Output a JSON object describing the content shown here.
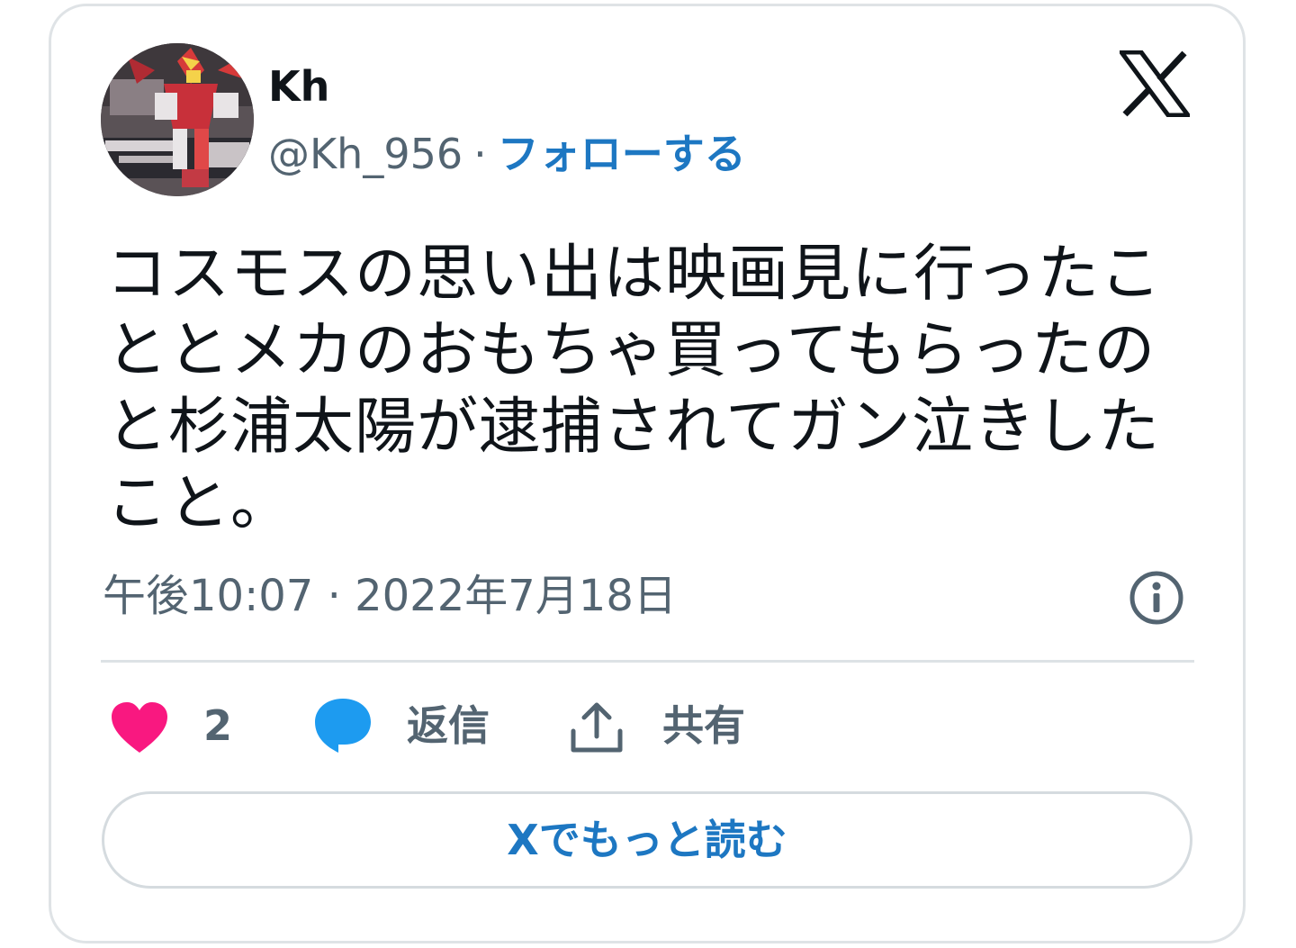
{
  "author": {
    "display_name": "Kh",
    "handle": "@Kh_956",
    "separator": "·",
    "follow_label": "フォローする"
  },
  "brand": {
    "logo_icon": "x-logo-icon"
  },
  "tweet": {
    "text": "コスモスの思い出は映画見に行ったこととメカのおもちゃ買ってもらったのと杉浦太陽が逮捕されてガン泣きしたこと。",
    "timestamp": "午後10:07 · 2022年7月18日"
  },
  "actions": {
    "like_icon": "heart-icon",
    "like_count": "2",
    "reply_icon": "speech-bubble-icon",
    "reply_label": "返信",
    "share_icon": "share-upload-icon",
    "share_label": "共有"
  },
  "footer": {
    "read_more_label": "Xでもっと読む"
  },
  "colors": {
    "text_primary": "#0f1419",
    "text_secondary": "#536471",
    "link_blue": "#1d77c2",
    "like_pink": "#f91880",
    "reply_blue": "#1d9bf0",
    "border": "#dfe3e6"
  }
}
